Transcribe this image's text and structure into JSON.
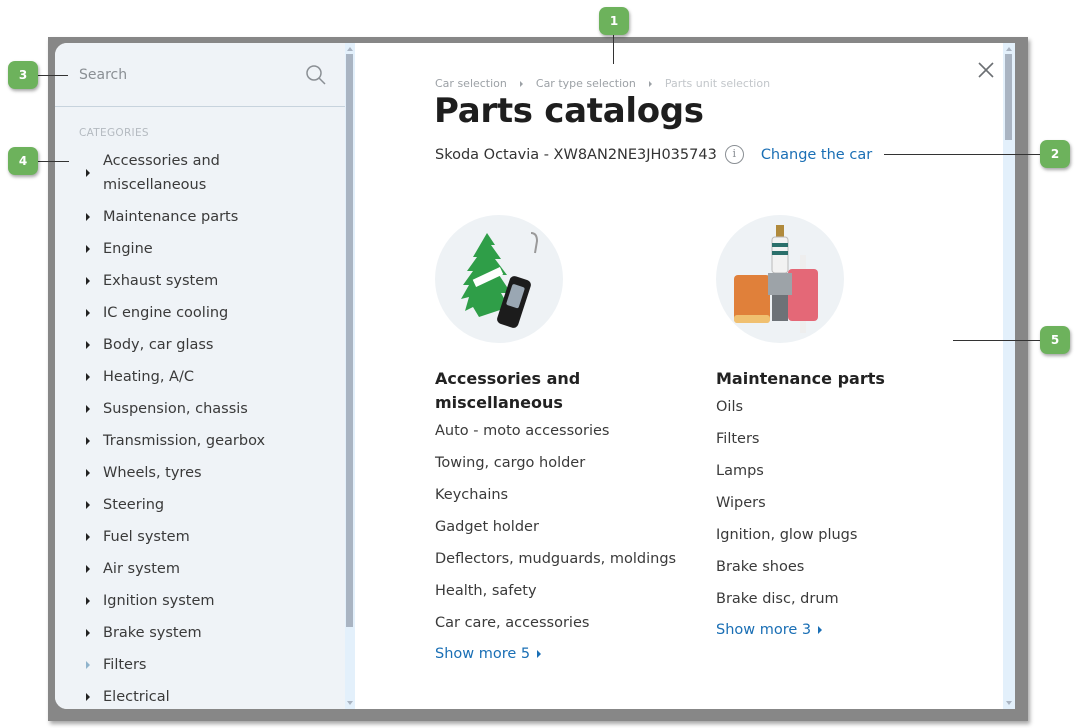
{
  "sidebar": {
    "search_placeholder": "Search",
    "categories_label": "CATEGORIES",
    "categories": [
      "Accessories and miscellaneous",
      "Maintenance parts",
      "Engine",
      "Exhaust system",
      "IC engine cooling",
      "Body, car glass",
      "Heating, A/C",
      "Suspension, chassis",
      "Transmission, gearbox",
      "Wheels, tyres",
      "Steering",
      "Fuel system",
      "Air system",
      "Ignition system",
      "Brake system",
      "Filters",
      "Electrical"
    ]
  },
  "breadcrumb": [
    "Car selection",
    "Car type selection",
    "Parts unit selection"
  ],
  "header": {
    "title": "Parts catalogs",
    "car": "Skoda Octavia - XW8AN2NE3JH035743",
    "info_icon": "i",
    "change_car": "Change the car"
  },
  "cards": [
    {
      "title": "Accessories and miscellaneous",
      "image": "air-freshener-and-keyfob",
      "items": [
        "Auto - moto accessories",
        "Towing, cargo holder",
        "Keychains",
        "Gadget holder",
        "Deflectors, mudguards, moldings",
        "Health, safety",
        "Car care, accessories"
      ],
      "show_more": "Show more 5"
    },
    {
      "title": "Maintenance parts",
      "image": "filters-and-spark-plug",
      "items": [
        "Oils",
        "Filters",
        "Lamps",
        "Wipers",
        "Ignition, glow plugs",
        "Brake shoes",
        "Brake disc, drum"
      ],
      "show_more": "Show more 3"
    }
  ],
  "callouts": [
    "1",
    "2",
    "3",
    "4",
    "5"
  ],
  "colors": {
    "accent_link": "#1a6fb5",
    "sidebar_bg": "#eff3f7",
    "callout_green": "#6db25c",
    "frame_grey": "#878787"
  }
}
